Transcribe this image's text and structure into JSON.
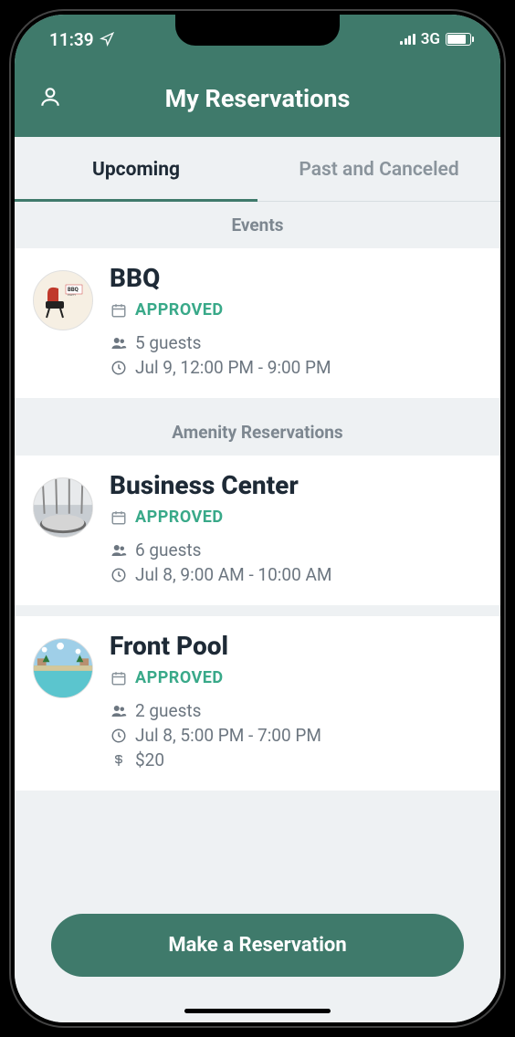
{
  "status_bar": {
    "time": "11:39",
    "network": "3G"
  },
  "header": {
    "title": "My Reservations"
  },
  "tabs": {
    "upcoming": "Upcoming",
    "past": "Past and Canceled"
  },
  "sections": {
    "events": "Events",
    "amenities": "Amenity Reservations"
  },
  "reservations": {
    "bbq": {
      "title": "BBQ",
      "status": "APPROVED",
      "guests": "5 guests",
      "time": "Jul 9, 12:00 PM - 9:00 PM"
    },
    "business_center": {
      "title": "Business Center",
      "status": "APPROVED",
      "guests": "6 guests",
      "time": "Jul 8, 9:00 AM - 10:00 AM"
    },
    "front_pool": {
      "title": "Front Pool",
      "status": "APPROVED",
      "guests": "2 guests",
      "time": "Jul 8, 5:00 PM - 7:00 PM",
      "price": "$20"
    }
  },
  "cta": {
    "make_reservation": "Make a Reservation"
  },
  "colors": {
    "primary": "#3f7a6b",
    "approved": "#39a989",
    "text_dark": "#1e2a36",
    "text_muted": "#6c7680"
  }
}
